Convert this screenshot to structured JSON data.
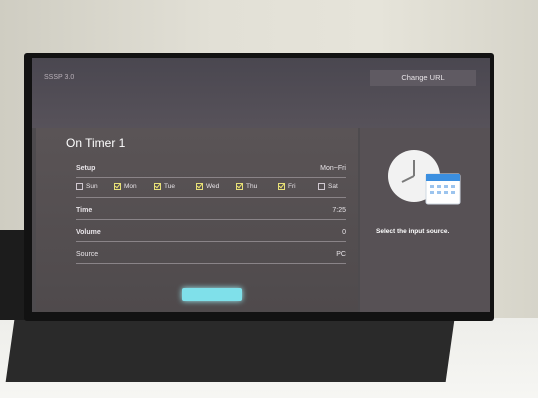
{
  "header": {
    "app_label": "SSSP 3.0",
    "change_url_label": "Change URL"
  },
  "timer": {
    "title": "On Timer 1",
    "setup_label": "Setup",
    "setup_value": "Mon~Fri",
    "days": [
      {
        "label": "Sun",
        "checked": false
      },
      {
        "label": "Mon",
        "checked": true
      },
      {
        "label": "Tue",
        "checked": true
      },
      {
        "label": "Wed",
        "checked": true
      },
      {
        "label": "Thu",
        "checked": true
      },
      {
        "label": "Fri",
        "checked": true
      },
      {
        "label": "Sat",
        "checked": false
      }
    ],
    "time_label": "Time",
    "time_value": "7:25",
    "volume_label": "Volume",
    "volume_value": "0",
    "source_label": "Source",
    "source_value": "PC"
  },
  "side": {
    "hint": "Select the input source.",
    "icon": "clock-calendar-icon"
  }
}
